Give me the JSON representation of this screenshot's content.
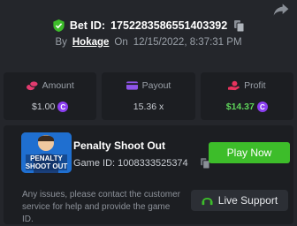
{
  "header": {
    "bet_id_label": "Bet ID:",
    "bet_id_value": "1752283586551403392",
    "by_label": "By",
    "username": "Hokage",
    "on_label": "On",
    "date": "12/15/2022, 8:37:31 PM"
  },
  "stats": {
    "amount": {
      "label": "Amount",
      "value": "$1.00",
      "icon": "coins-icon"
    },
    "payout": {
      "label": "Payout",
      "value": "15.36 x",
      "icon": "wallet-icon"
    },
    "profit": {
      "label": "Profit",
      "value": "$14.37",
      "icon": "hand-coin-icon"
    },
    "currency_glyph": "C"
  },
  "game": {
    "name": "Penalty Shoot Out",
    "id_label": "Game ID:",
    "id_value": "1008333525374",
    "thumbnail_lines": [
      "PENALTY",
      "SHOOT OUT"
    ],
    "play_label": "Play Now"
  },
  "support": {
    "notice": "Any issues, please contact the customer service for help and provide the game ID.",
    "button_label": "Live Support"
  },
  "colors": {
    "background": "#24262b",
    "panel": "#1c1e22",
    "accent_green": "#3dbd2a",
    "profit_green": "#5ed35a",
    "coin_purple": "#8b3ef0",
    "amount_pink": "#e23b6f",
    "payout_purple": "#8e54e9",
    "profit_red": "#e8335d"
  }
}
